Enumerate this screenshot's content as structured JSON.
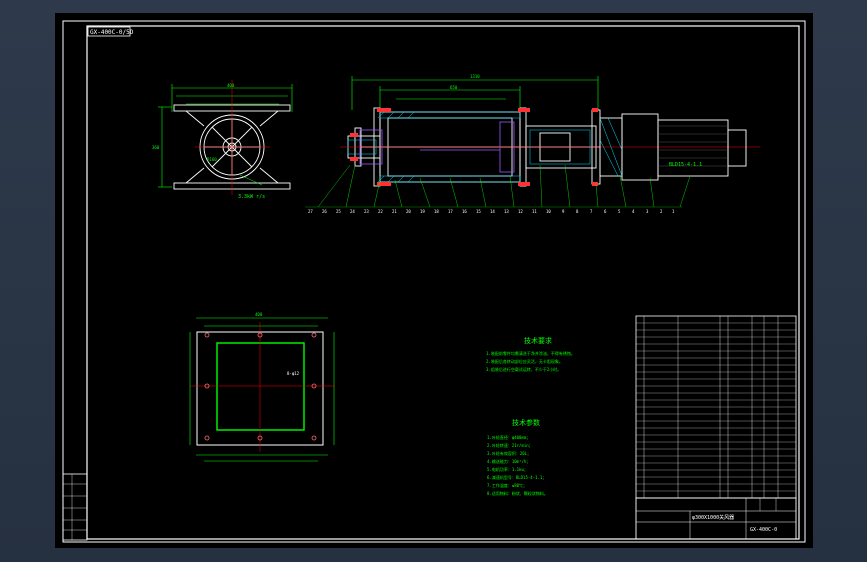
{
  "drawing_code": "GX-400C-0/5D",
  "technical_requirements": {
    "title": "技术要求",
    "lines": [
      "1.装配前零件均需清洗干净并涂油，不得有锈蚀。",
      "2.装配后各转动部位应灵活，无卡阻现象。",
      "3.组装后进行空载试运转，不少于2小时。"
    ]
  },
  "technical_parameters": {
    "title": "技术参数",
    "lines": [
      "1.叶轮直径：φ400mm；",
      "2.叶轮转速：21r/min；",
      "3.叶轮有效容积：20L；",
      "4.输送能力：10m³/h；",
      "5.电机功率：1.1kw；",
      "6.减速机型号：BLD15-4-1.1；",
      "7.工作温度：≤80℃；",
      "8.适用物料：粉状、颗粒状物料。"
    ]
  },
  "title_block": {
    "name": "φ300X1000关风器",
    "code": "GX-400C-0"
  },
  "view_labels": {
    "side_view_note": "3.3kW r/s",
    "main_view_note": "BLD15-4-1.1"
  },
  "colors": {
    "sheet": "#000000",
    "outer": "#2b3544",
    "border": "#ffffff",
    "geometry": "#ffffff",
    "dimension": "#00ff00",
    "centerline": "#ff0000",
    "hatch": "#00e0ff",
    "text_annot": "#00ff00",
    "purple": "#9b59ff",
    "yellow": "#ffff66"
  }
}
